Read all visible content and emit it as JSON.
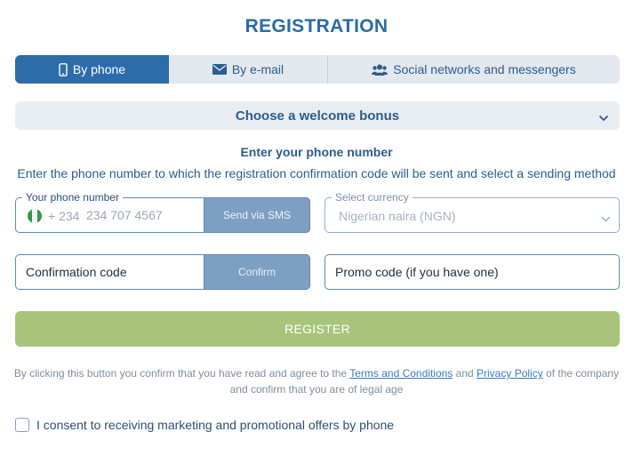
{
  "title": "REGISTRATION",
  "tabs": [
    {
      "label": "By phone",
      "icon": "smartphone-icon",
      "active": true
    },
    {
      "label": "By e-mail",
      "icon": "envelope-icon",
      "active": false
    },
    {
      "label": "Social networks and messengers",
      "icon": "users-icon",
      "active": false
    }
  ],
  "bonus": {
    "label": "Choose a welcome bonus",
    "icon": "chevron-down-icon"
  },
  "phone_section": {
    "title": "Enter your phone number",
    "description": "Enter the phone number to which the registration confirmation code will be sent and select a sending method"
  },
  "phone_field": {
    "legend": "Your phone number",
    "prefix": "+ 234",
    "placeholder": "234 707 4567",
    "flag": "nigeria-flag-icon",
    "send_button": "Send via SMS"
  },
  "currency_field": {
    "legend": "Select currency",
    "value": "Nigerian naira (NGN)"
  },
  "code_field": {
    "placeholder": "Confirmation code",
    "confirm_button": "Confirm"
  },
  "promo_field": {
    "placeholder": "Promo code (if you have one)"
  },
  "register_button": "REGISTER",
  "terms": {
    "prefix": "By clicking this button you confirm that you have read and agree to the",
    "terms_link": "Terms and Conditions",
    "and": "and",
    "privacy_link": "Privacy Policy",
    "suffix": "of the company",
    "line2": "and confirm that you are of legal age"
  },
  "consent": {
    "label": "I consent to receiving marketing and promotional offers by phone",
    "checked": false
  },
  "colors": {
    "primary": "#2d6cab",
    "register": "#a8c47a",
    "tab_bg": "#e2e8ee",
    "button_disabled": "#7da0c2"
  }
}
